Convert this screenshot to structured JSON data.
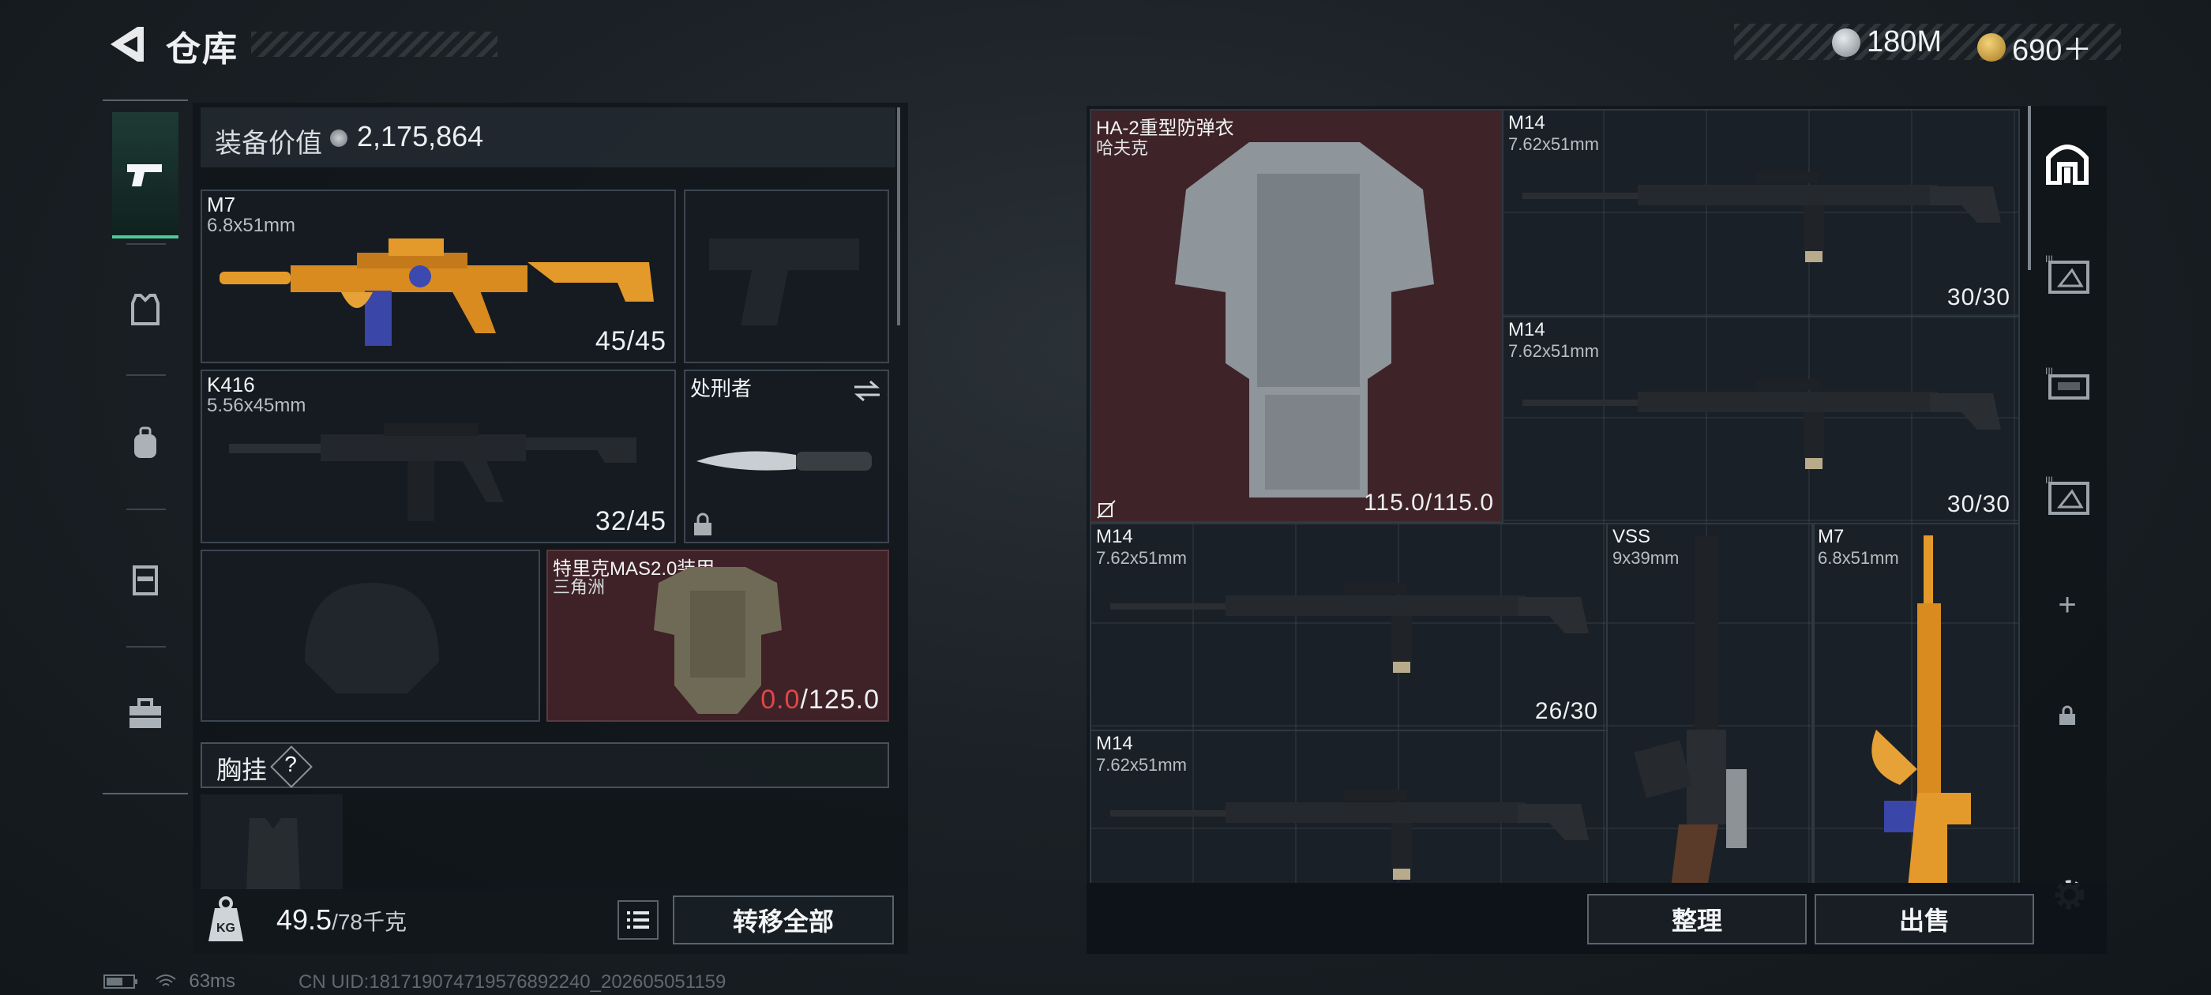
{
  "header": {
    "title": "仓库"
  },
  "currency": [
    {
      "icon": "silver-coin-icon",
      "value": "180M",
      "color": "#c0c6cb"
    },
    {
      "icon": "gold-coin-icon",
      "value": "690＋",
      "color": "#d3a741"
    }
  ],
  "left_nav": [
    {
      "icon": "pistol-icon",
      "active": true
    },
    {
      "icon": "armor-vest-icon",
      "active": false
    },
    {
      "icon": "backpack-icon",
      "active": false
    },
    {
      "icon": "chest-rig-icon",
      "active": false
    },
    {
      "icon": "briefcase-icon",
      "active": false
    }
  ],
  "equipment": {
    "value_label": "装备价值",
    "value": "2,175,864",
    "primary": {
      "name": "M7",
      "caliber": "6.8x51mm",
      "ammo": "45/45"
    },
    "secondary": {
      "name": "K416",
      "caliber": "5.56x45mm",
      "ammo": "32/45"
    },
    "melee": {
      "name": "处刑者"
    },
    "armor": {
      "name": "特里克MAS2.0装甲",
      "sub": "三角洲",
      "durability_current": "0.0",
      "durability_max": "/125.0"
    },
    "chest_rig_label": "胸挂",
    "chest_help": "?"
  },
  "footer_left": {
    "weight": "49.5",
    "weight_max": "/78千克",
    "transfer_all": "转移全部"
  },
  "storage": [
    {
      "name": "HA-2重型防弹衣",
      "sub": "哈夫克",
      "count": "115.0/115.0"
    },
    {
      "name": "M14",
      "sub": "7.62x51mm",
      "count": "30/30"
    },
    {
      "name": "M14",
      "sub": "7.62x51mm",
      "count": "30/30"
    },
    {
      "name": "M14",
      "sub": "7.62x51mm",
      "count": "26/30"
    },
    {
      "name": "VSS",
      "sub": "9x39mm",
      "count": ""
    },
    {
      "name": "M7",
      "sub": "6.8x51mm",
      "count": ""
    },
    {
      "name": "M14",
      "sub": "7.62x51mm",
      "count": ""
    }
  ],
  "right_nav": [
    {
      "icon": "safe-box-icon"
    },
    {
      "icon": "container-3-icon"
    },
    {
      "icon": "container-2-icon"
    },
    {
      "icon": "container-1-icon"
    },
    {
      "icon": "add-icon",
      "glyph": "+"
    },
    {
      "icon": "lock-icon"
    }
  ],
  "footer_right": {
    "organize": "整理",
    "sell": "出售"
  },
  "status": {
    "ping": "63ms",
    "uid": "CN UID:181719074719576892240_202605051159"
  }
}
